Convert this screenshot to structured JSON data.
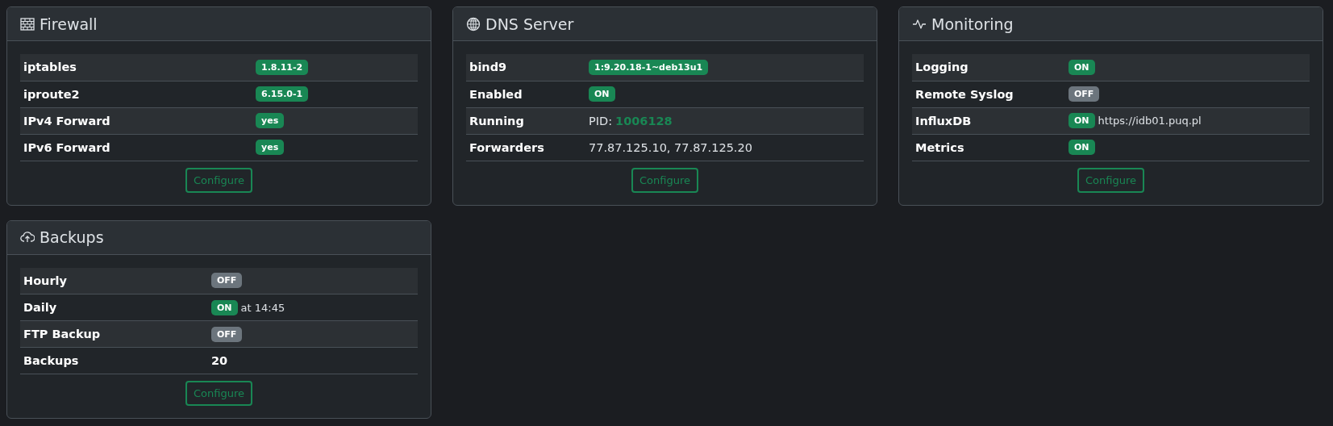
{
  "cards": [
    {
      "title": "Firewall",
      "rows": [
        {
          "label": "iptables",
          "value": [
            {
              "kind": "badge",
              "text": "1.8.11-2",
              "on": true
            }
          ]
        },
        {
          "label": "iproute2",
          "value": [
            {
              "kind": "badge",
              "text": "6.15.0-1",
              "on": true
            }
          ]
        },
        {
          "label": "IPv4 Forward",
          "value": [
            {
              "kind": "badge",
              "text": "yes",
              "on": true
            }
          ]
        },
        {
          "label": "IPv6 Forward",
          "value": [
            {
              "kind": "badge",
              "text": "yes",
              "on": true
            }
          ]
        }
      ],
      "button": "Configure"
    },
    {
      "title": "DNS Server",
      "rows": [
        {
          "label": "bind9",
          "value": [
            {
              "kind": "badge",
              "text": "1:9.20.18-1~deb13u1",
              "on": true
            }
          ]
        },
        {
          "label": "Enabled",
          "value": [
            {
              "kind": "badge",
              "text": "ON",
              "on": true
            }
          ]
        },
        {
          "label": "Running",
          "value": [
            {
              "kind": "text",
              "text": "PID:"
            },
            {
              "kind": "pid",
              "text": "1006128"
            }
          ]
        },
        {
          "label": "Forwarders",
          "value": [
            {
              "kind": "text",
              "text": "77.87.125.10, 77.87.125.20"
            }
          ]
        }
      ],
      "button": "Configure"
    },
    {
      "title": "Monitoring",
      "rows": [
        {
          "label": "Logging",
          "value": [
            {
              "kind": "badge",
              "text": "ON",
              "on": true
            }
          ]
        },
        {
          "label": "Remote Syslog",
          "value": [
            {
              "kind": "badge",
              "text": "OFF",
              "on": false
            }
          ]
        },
        {
          "label": "InfluxDB",
          "value": [
            {
              "kind": "badge",
              "text": "ON",
              "on": true
            },
            {
              "kind": "small",
              "text": "https://idb01.puq.pl"
            }
          ]
        },
        {
          "label": "Metrics",
          "value": [
            {
              "kind": "badge",
              "text": "ON",
              "on": true
            }
          ]
        }
      ],
      "button": "Configure"
    },
    {
      "title": "Backups",
      "rows": [
        {
          "label": "Hourly",
          "value": [
            {
              "kind": "badge",
              "text": "OFF",
              "on": false
            }
          ]
        },
        {
          "label": "Daily",
          "value": [
            {
              "kind": "badge",
              "text": "ON",
              "on": true
            },
            {
              "kind": "small",
              "text": "at 14:45"
            }
          ]
        },
        {
          "label": "FTP Backup",
          "value": [
            {
              "kind": "badge",
              "text": "OFF",
              "on": false
            }
          ]
        },
        {
          "label": "Backups",
          "value": [
            {
              "kind": "count",
              "text": "20"
            }
          ]
        }
      ],
      "button": "Configure"
    }
  ]
}
